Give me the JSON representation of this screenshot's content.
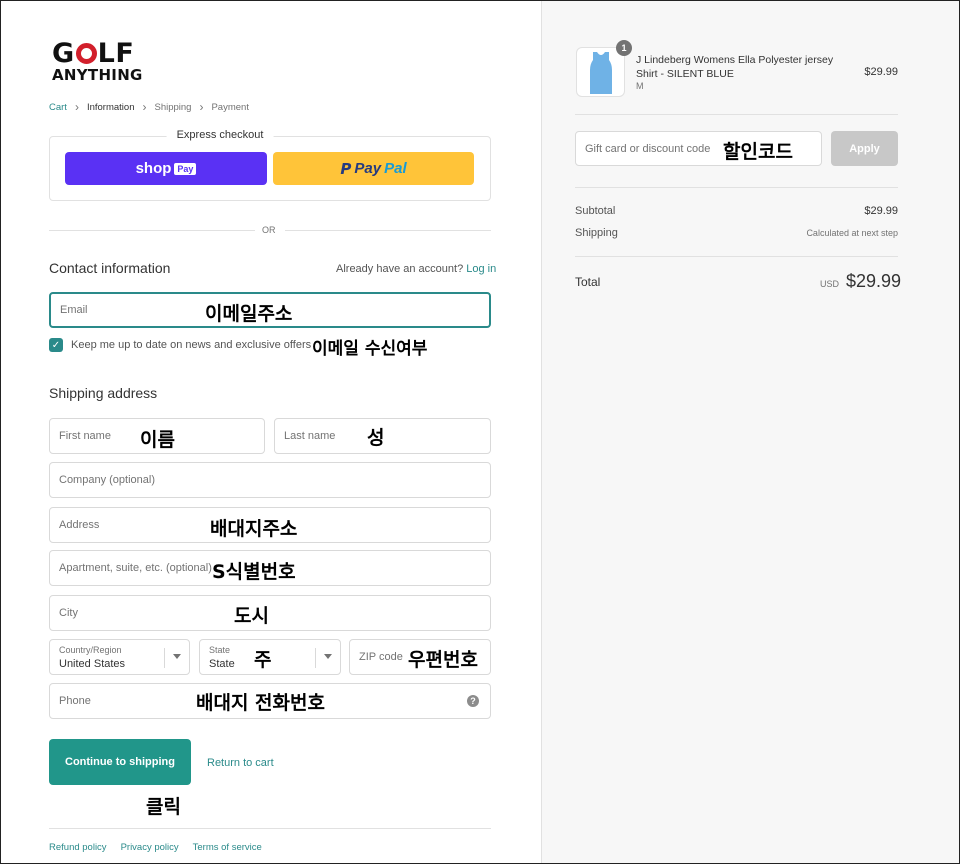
{
  "brand": {
    "line1_a": "G",
    "line1_b": "LF",
    "line2": "ANYTHING",
    "accent": "#d21f2b"
  },
  "breadcrumb": {
    "cart": "Cart",
    "information": "Information",
    "shipping": "Shipping",
    "payment": "Payment"
  },
  "express": {
    "title": "Express checkout",
    "shop_label": "shop",
    "shop_pay": "Pay",
    "paypal_a": "Pay",
    "paypal_b": "Pal",
    "or": "OR"
  },
  "contact": {
    "title": "Contact information",
    "have_account": "Already have an account?",
    "login": "Log in",
    "email_placeholder": "Email",
    "newsletter": "Keep me up to date on news and exclusive offers"
  },
  "shipping": {
    "title": "Shipping address",
    "first_name": "First name",
    "last_name": "Last name",
    "company": "Company (optional)",
    "address": "Address",
    "apartment": "Apartment, suite, etc. (optional)",
    "city": "City",
    "country_label": "Country/Region",
    "country_value": "United States",
    "state_label": "State",
    "state_value": "State",
    "zip": "ZIP code",
    "phone": "Phone"
  },
  "actions": {
    "continue": "Continue to shipping",
    "return": "Return to cart"
  },
  "footer": {
    "refund": "Refund policy",
    "privacy": "Privacy policy",
    "terms": "Terms of service"
  },
  "annotations": {
    "email": "이메일주소",
    "newsletter": "이메일 수신여부",
    "first_name": "이름",
    "last_name": "성",
    "address": "배대지주소",
    "apartment": "S식별번호",
    "city": "도시",
    "state": "주",
    "zip": "우편번호",
    "phone": "배대지 전화번호",
    "continue": "클릭",
    "discount": "할인코드"
  },
  "summary": {
    "quantity": "1",
    "product_name": "J Lindeberg Womens Ella Polyester jersey Shirt - SILENT BLUE",
    "variant": "M",
    "product_price": "$29.99",
    "discount_placeholder": "Gift card or discount code",
    "apply": "Apply",
    "subtotal_label": "Subtotal",
    "subtotal_value": "$29.99",
    "shipping_label": "Shipping",
    "shipping_value": "Calculated at next step",
    "total_label": "Total",
    "currency": "USD",
    "total_value": "$29.99"
  },
  "colors": {
    "primary": "#21968a",
    "shop_pay": "#5a31f4",
    "paypal": "#ffc439",
    "product": "#6fb2e6"
  }
}
